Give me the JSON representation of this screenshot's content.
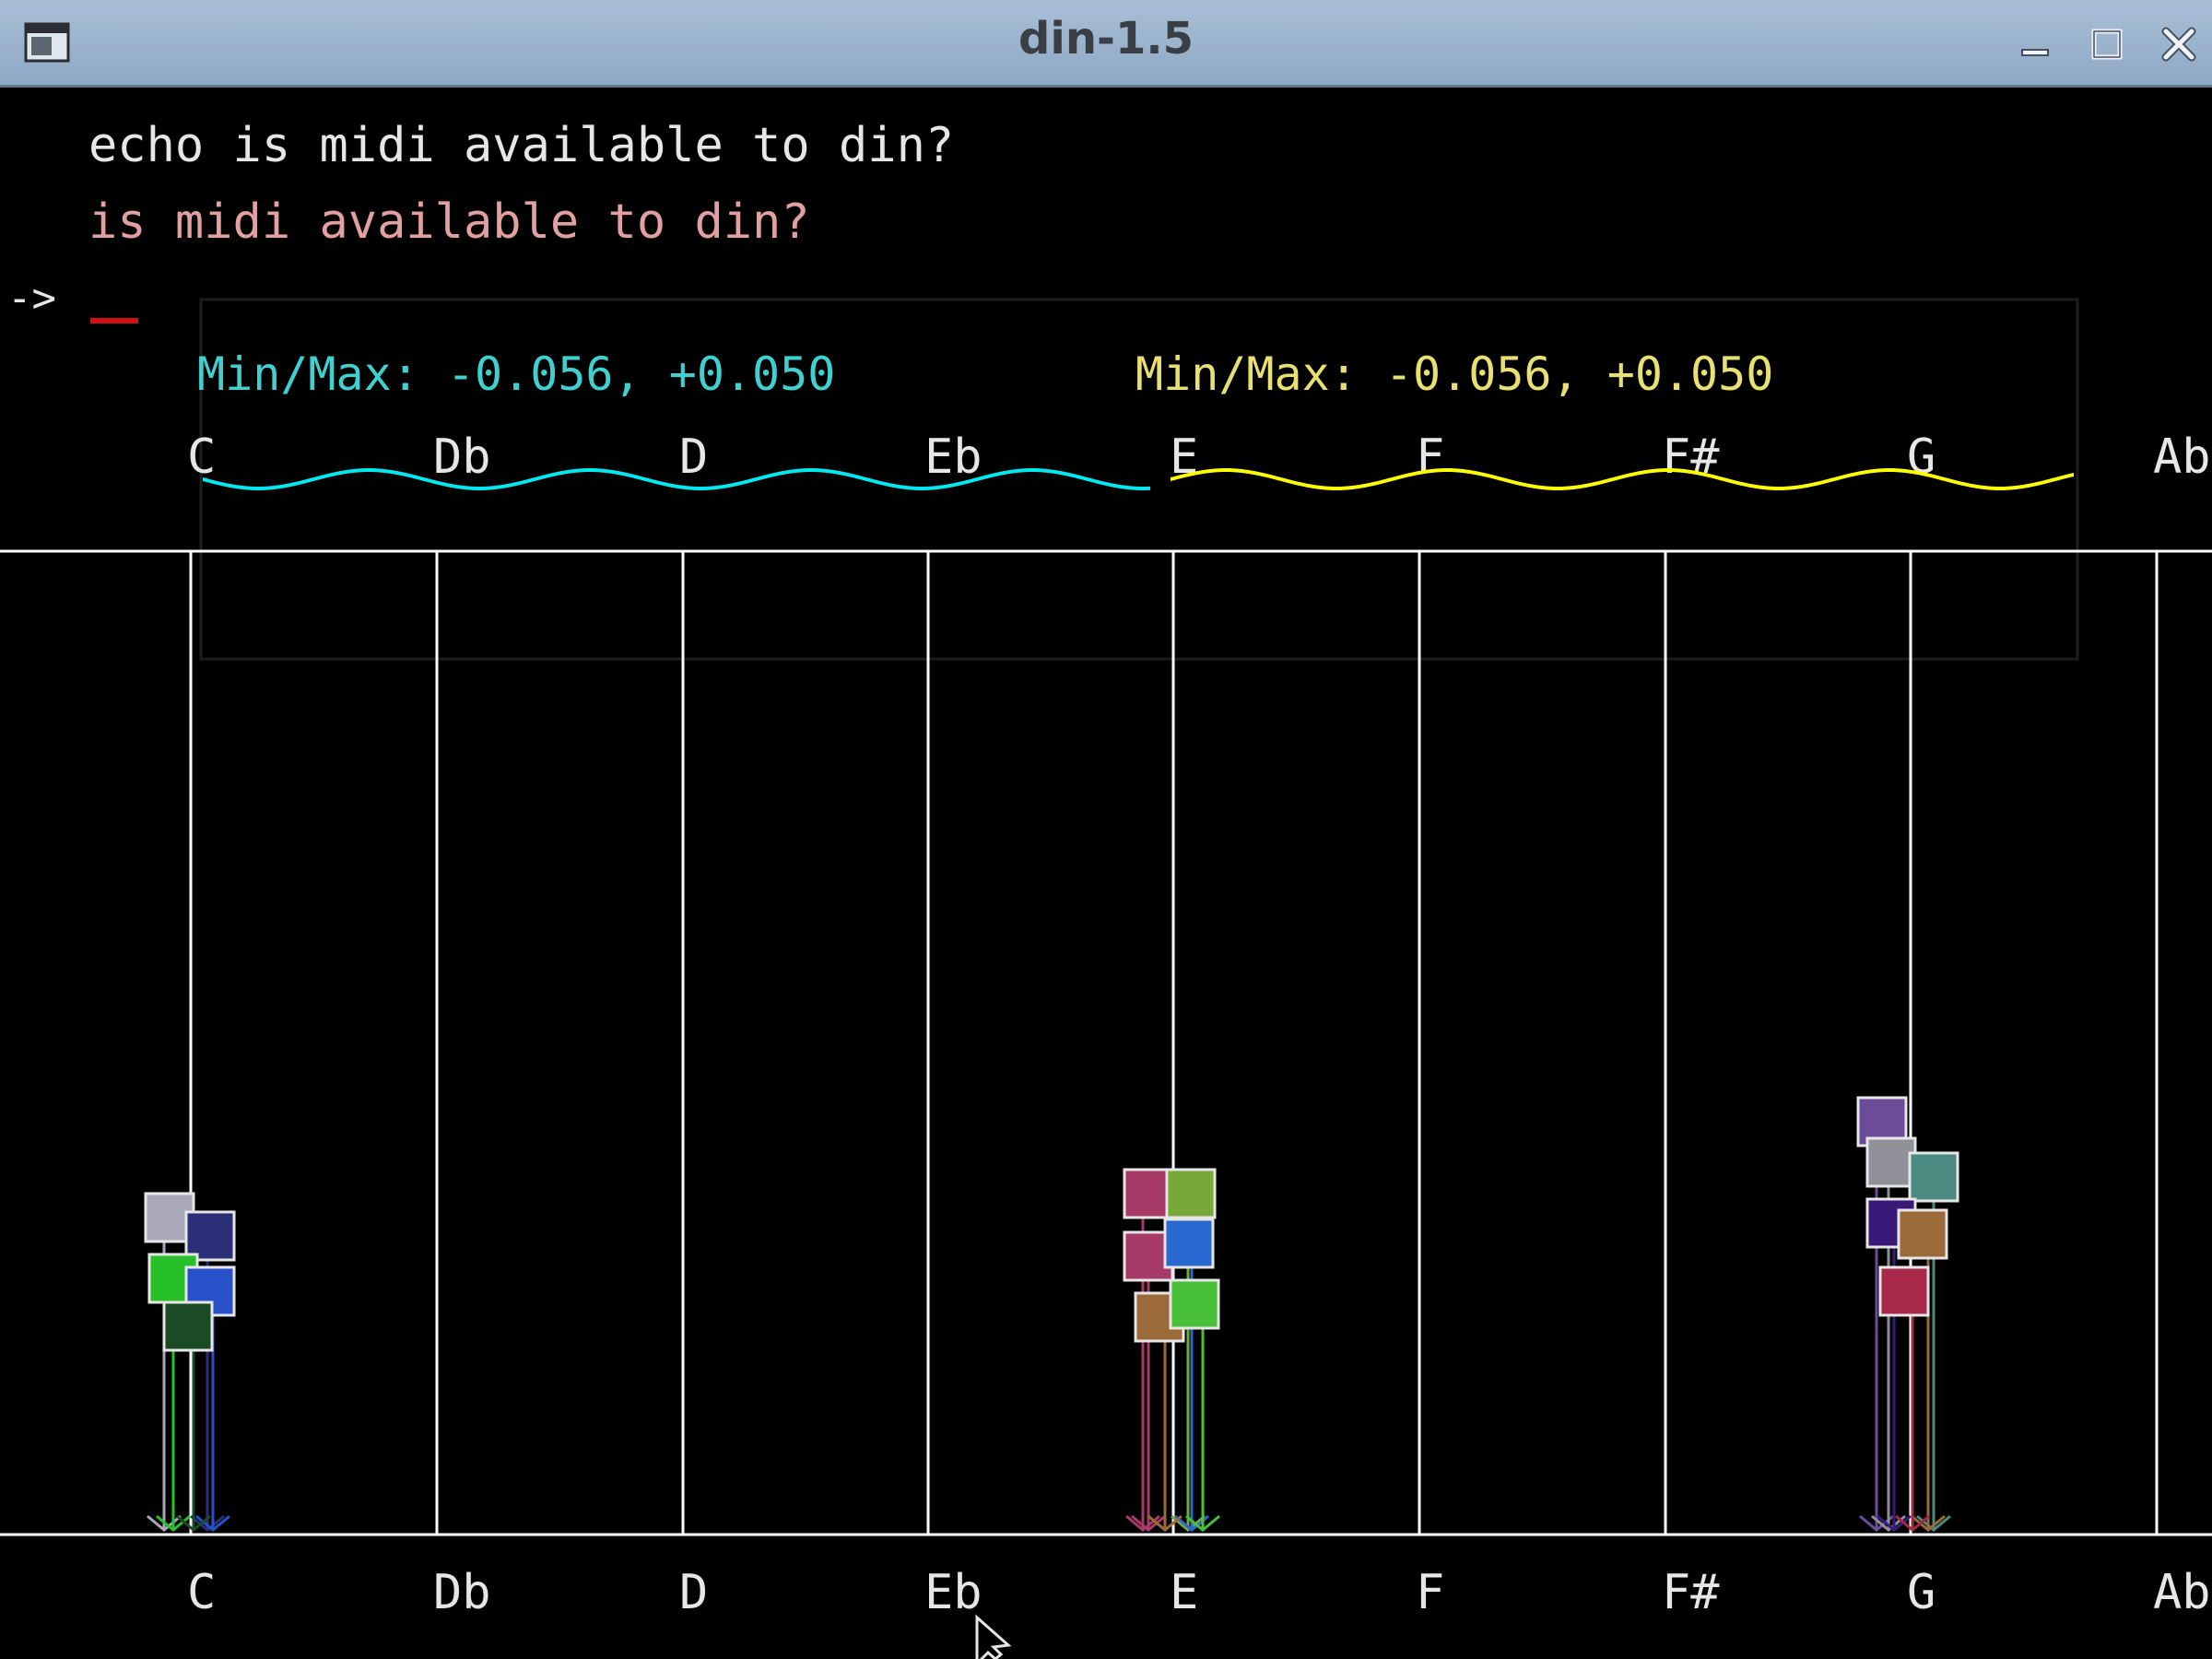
{
  "window": {
    "title": "din-1.5"
  },
  "icons": {
    "app": "app-window-icon",
    "minimize": "minimize-icon",
    "maximize": "maximize-icon",
    "close": "close-icon",
    "cursor": "mouse-pointer-icon"
  },
  "console": {
    "line1": "echo is midi available to din?",
    "line2": "is midi available to din?",
    "prompt": "->",
    "line1_color": "#e6e6e6",
    "line2_color": "#e3a0a0",
    "cursor_color": "#d01010"
  },
  "waveform_panel": {
    "left_minmax": "Min/Max: -0.056, +0.050",
    "right_minmax": "Min/Max: -0.056, +0.050",
    "left_color": "#3fd0d0",
    "right_color": "#e8e070",
    "left_wave_color": "#00e8f0",
    "right_wave_color": "#ffff00"
  },
  "notes": [
    "C",
    "Db",
    "D",
    "Eb",
    "E",
    "F",
    "F#",
    "G",
    "Ab"
  ],
  "note_groups": [
    {
      "note": "C",
      "boxes": [
        {
          "color": "#a8a8b8"
        },
        {
          "color": "#2c2e78"
        },
        {
          "color": "#28c028"
        },
        {
          "color": "#2850c8"
        },
        {
          "color": "#1a4a26"
        }
      ]
    },
    {
      "note": "E",
      "boxes": [
        {
          "color": "#a83a68"
        },
        {
          "color": "#78a838"
        },
        {
          "color": "#a83a68"
        },
        {
          "color": "#2868d0"
        },
        {
          "color": "#9a6a38"
        },
        {
          "color": "#48c038"
        }
      ]
    },
    {
      "note": "G",
      "boxes": [
        {
          "color": "#6c4c98"
        },
        {
          "color": "#909098"
        },
        {
          "color": "#4a8a80"
        },
        {
          "color": "#3a1a78"
        },
        {
          "color": "#9a6a38"
        },
        {
          "color": "#a8284a"
        }
      ]
    }
  ]
}
